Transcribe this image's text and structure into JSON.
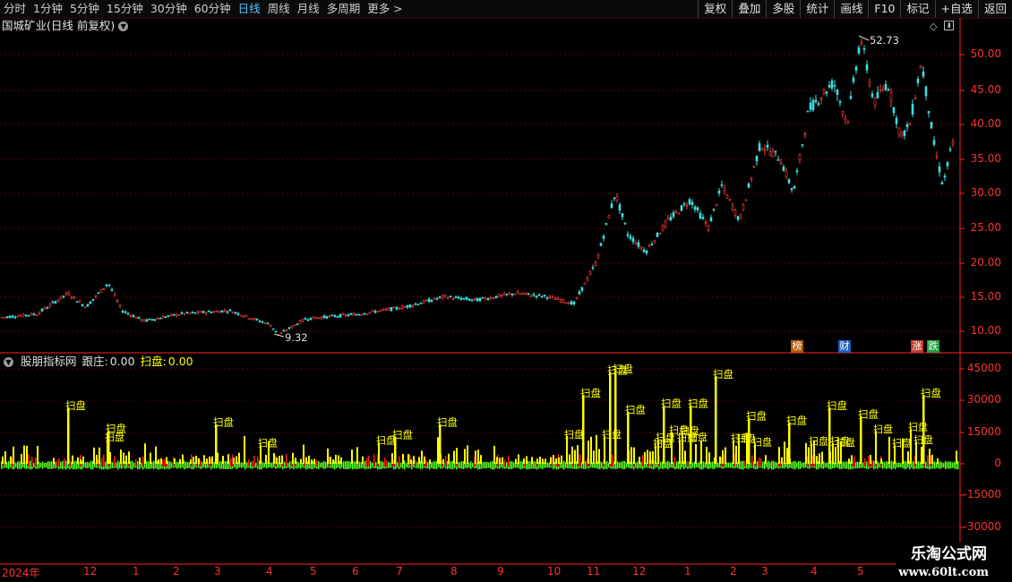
{
  "toolbar": {
    "periods": [
      "分时",
      "1分钟",
      "5分钟",
      "15分钟",
      "30分钟",
      "60分钟",
      "日线",
      "周线",
      "月线",
      "多周期",
      "更多 >"
    ],
    "active_period": "日线",
    "right_buttons": [
      "复权",
      "叠加",
      "多股",
      "统计",
      "画线",
      "F10",
      "标记",
      "+自选",
      "返回"
    ]
  },
  "main_chart": {
    "title": "国城矿业(日线 前复权)",
    "high_label": "52.73",
    "low_label": "9.32",
    "y_ticks": [
      "50.00",
      "45.00",
      "40.00",
      "35.00",
      "30.00",
      "25.00",
      "20.00",
      "15.00",
      "10.00"
    ],
    "badges": [
      {
        "text": "榜",
        "color": "#b35a00"
      },
      {
        "text": "财",
        "color": "#1f5fbf"
      },
      {
        "text": "涨",
        "color": "#c0392b"
      },
      {
        "text": "跌",
        "color": "#1f9f3f"
      }
    ],
    "colors": {
      "up": "#ff3b3b",
      "down": "#3fe0e0",
      "axis": "#ff2020",
      "grid": "#5a0000"
    }
  },
  "indicator": {
    "name": "股朋指标网",
    "field1_label": "跟庄:",
    "field1_value": "0.00",
    "field2_label": "扫盘:",
    "field2_value": "0.00",
    "bar_label": "扫盘",
    "y_ticks": [
      "45000",
      "30000",
      "15000",
      "0",
      "-15000",
      "-30000"
    ],
    "colors": {
      "yellow": "#ffff00",
      "green": "#55ff22",
      "red": "#ff1a1a"
    }
  },
  "x_axis": {
    "labels": [
      "2024年",
      "12",
      "1",
      "2",
      "3",
      "4",
      "5",
      "6",
      "7",
      "8",
      "9",
      "10",
      "11",
      "12",
      "1",
      "2",
      "3",
      "4",
      "5"
    ]
  },
  "watermark": {
    "line1": "乐淘公式网",
    "line2": "www.60lt.com"
  }
}
